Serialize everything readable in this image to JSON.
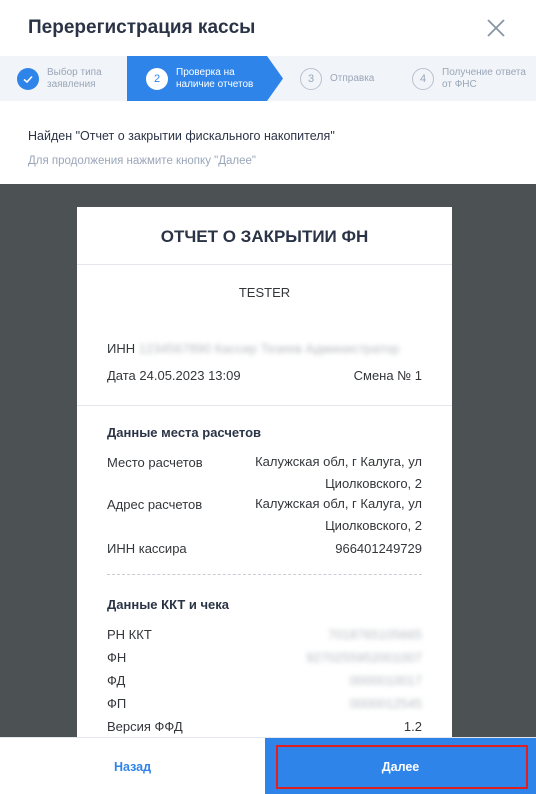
{
  "dialog": {
    "title": "Перерегистрация кассы",
    "close_icon": "close-icon"
  },
  "steps": [
    {
      "number": "",
      "label": "Выбор типа заявления",
      "state": "done"
    },
    {
      "number": "2",
      "label": "Проверка на наличие отчетов",
      "state": "active"
    },
    {
      "number": "3",
      "label": "Отправка",
      "state": "pending"
    },
    {
      "number": "4",
      "label": "Получение ответа от ФНС",
      "state": "pending"
    }
  ],
  "message": {
    "found": "Найден \"Отчет о закрытии фискального накопителя\"",
    "hint": "Для продолжения нажмите кнопку \"Далее\""
  },
  "receipt": {
    "title": "ОТЧЕТ О ЗАКРЫТИИ ФН",
    "org": "TESTER",
    "inn_label": "ИНН",
    "inn_value": "1234567890",
    "cashier": "Кассир Тезеев Администратор",
    "date": "Дата 24.05.2023 13:09",
    "shift": "Смена № 1",
    "place_section": "Данные места расчетов",
    "place_label": "Место расчетов",
    "place_value_1": "Калужская обл, г Калуга, ул",
    "place_value_2": "Циолковского, 2",
    "address_label": "Адрес расчетов",
    "address_value_1": "Калужская обл, г Калуга, ул",
    "address_value_2": "Циолковского, 2",
    "cashier_inn_label": "ИНН кассира",
    "cashier_inn_value": "966401249729",
    "kkt_section": "Данные ККТ и чека",
    "rn_label": "РН ККТ",
    "rn_value": "7018765105665",
    "fn_label": "ФН",
    "fn_value": "9270255952001007",
    "fd_label": "ФД",
    "fd_value": "0000010017",
    "fp_label": "ФП",
    "fp_value": "0000012545",
    "ffd_label": "Версия ФФД",
    "ffd_value": "1.2"
  },
  "footer": {
    "back_label": "Назад",
    "next_label": "Далее"
  },
  "colors": {
    "accent": "#2f84e9",
    "preview_bg": "#4c5154",
    "highlight": "#e02020"
  }
}
